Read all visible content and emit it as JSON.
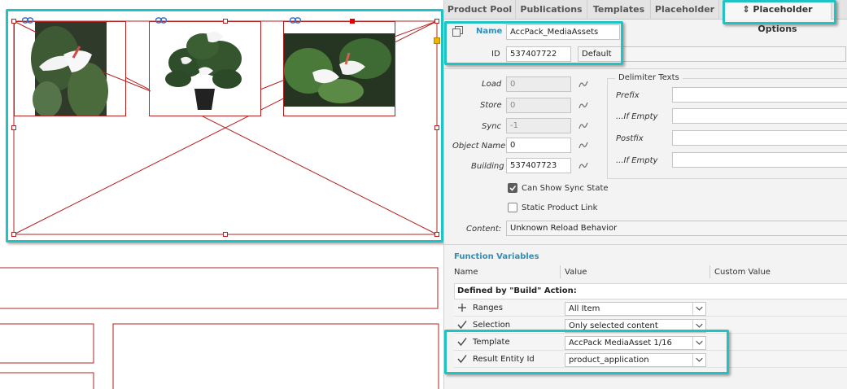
{
  "tabs": [
    {
      "label": "Product Pool"
    },
    {
      "label": "Publications"
    },
    {
      "label": "Templates"
    },
    {
      "label": "Placeholder"
    },
    {
      "label": "⇕ Placeholder Options"
    }
  ],
  "header": {
    "name_label": "Name",
    "name_value": "AccPack_MediaAssets",
    "id_label": "ID",
    "id_value": "537407722",
    "id_default": "Default"
  },
  "fields": {
    "load_label": "Load",
    "load_value": "0",
    "store_label": "Store",
    "store_value": "0",
    "sync_label": "Sync",
    "sync_value": "-1",
    "object_name_label": "Object Name",
    "object_name_value": "0",
    "building_label": "Building",
    "building_value": "537407723",
    "can_show_sync_label": "Can Show Sync State",
    "static_product_link_label": "Static Product Link",
    "content_label": "Content:",
    "content_value": "Unknown Reload Behavior"
  },
  "delimiter": {
    "title": "Delimiter Texts",
    "prefix_label": "Prefix",
    "if_empty_label": "...If Empty",
    "postfix_label": "Postfix",
    "if_empty2_label": "...If Empty"
  },
  "function_variables": {
    "title": "Function Variables",
    "col_name": "Name",
    "col_value": "Value",
    "col_custom": "Custom Value",
    "group_label": "Defined by \"Build\" Action:",
    "rows": [
      {
        "name": "Ranges",
        "value": "All Item"
      },
      {
        "name": "Selection",
        "value": "Only selected content"
      },
      {
        "name": "Template",
        "value": "AccPack MediaAsset 1/16"
      },
      {
        "name": "Result Entity Id",
        "value": "product_application"
      }
    ]
  },
  "colors": {
    "highlight": "#1fc3c3",
    "frame": "#b32020",
    "section_title": "#2f8fb8"
  }
}
